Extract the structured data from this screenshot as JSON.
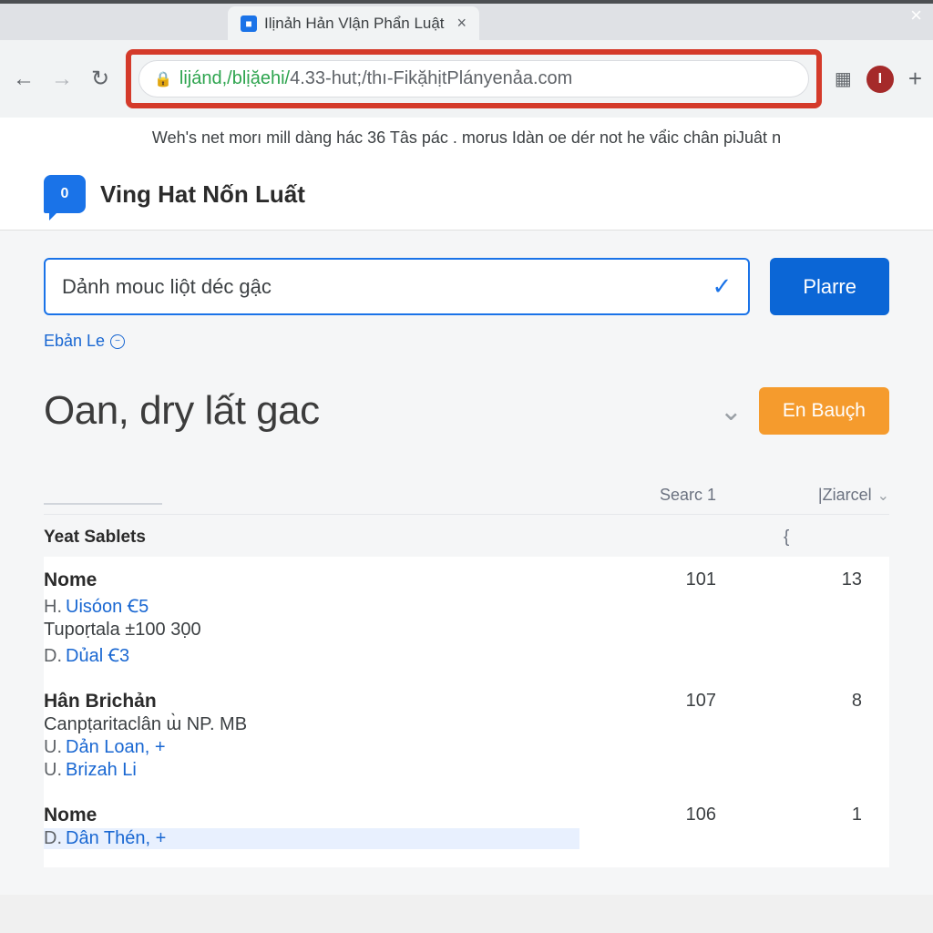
{
  "browser": {
    "tab_title": "Ilịnảh Hản Vlận Phẩn Luật",
    "close_window": "×",
    "close_tab": "×",
    "favicon_letter": "■",
    "nav": {
      "back": "←",
      "forward": "→",
      "reload": "⟳"
    },
    "url_green": "lijánd,/blịặehi/",
    "url_rest": "4.33-hut;/thı-FikặhịtPlányenảa.com",
    "avatar_letter": "I",
    "plus": "+"
  },
  "banner": "Weh's net morı mill dàng hác 36 Tâs pác . morus Idàn oe dér not he vẩic chân piJuât n",
  "app": {
    "logo_letter": "0",
    "title": "Ving Hat Nốn Luất"
  },
  "search": {
    "text": "Dảnh mouc liột déc gậc",
    "button": "Plarre"
  },
  "sublink": {
    "label": "Ebản Le",
    "icon": "⊖"
  },
  "page": {
    "title": "Oan, dry lất gac",
    "action": "En Bauçh"
  },
  "table": {
    "col_a": "Searc 1",
    "col_b": "|Ziarcel",
    "section": "Yeat Sablets",
    "section_brace": "{",
    "rows": [
      {
        "title": "Nome",
        "sub_link1_prefix": "H.",
        "sub_link1": "Uisóon Ꞓ5",
        "sub_text": "Tupoṛtala ±100 30̣0",
        "sub_link2_prefix": "D.",
        "sub_link2": "Dủal Ꞓ3",
        "a": "101",
        "b": "13"
      },
      {
        "title": "Hân Brichản",
        "sub_text": "Canpṭaritaclân ɯ̀ NP. MB",
        "sub_link1_prefix": "U.",
        "sub_link1": "Dản Loan, +",
        "sub_link2_prefix": "U.",
        "sub_link2": "Brizah Li",
        "a": "107",
        "b": "8"
      },
      {
        "title": "Nome",
        "sub_link1_prefix": "D.",
        "sub_link1": "Dân Thén, +",
        "a": "106",
        "b": "1",
        "highlight": true
      }
    ]
  }
}
